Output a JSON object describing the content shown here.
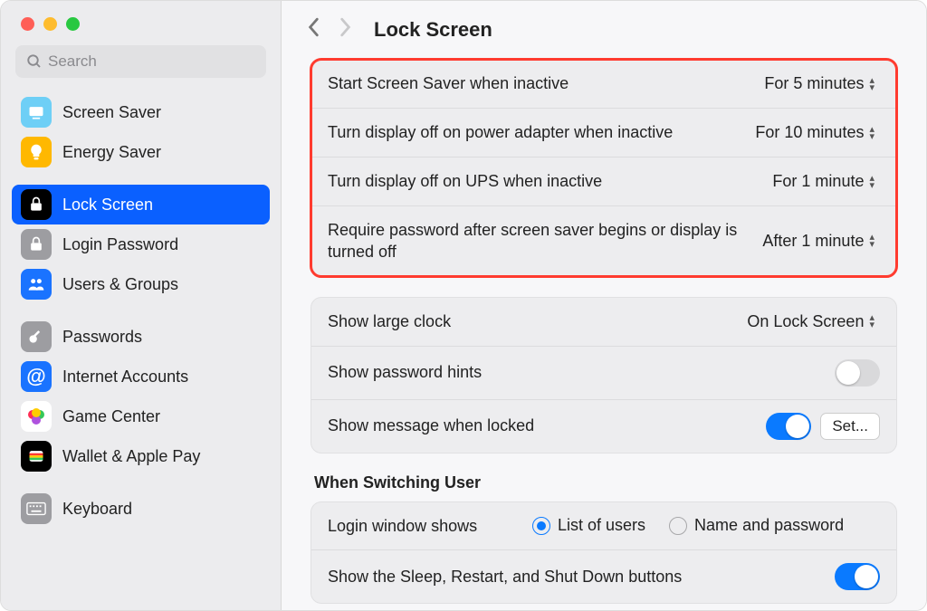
{
  "search": {
    "placeholder": "Search"
  },
  "header": {
    "title": "Lock Screen"
  },
  "sidebar": {
    "groups": [
      [
        {
          "label": "Screen Saver",
          "icon": "screen-saver",
          "bg": "#6ecff6"
        },
        {
          "label": "Energy Saver",
          "icon": "bulb",
          "bg": "#ffb800"
        }
      ],
      [
        {
          "label": "Lock Screen",
          "icon": "lock",
          "bg": "#000000",
          "selected": true
        },
        {
          "label": "Login Password",
          "icon": "lock-solid",
          "bg": "#9d9da1"
        },
        {
          "label": "Users & Groups",
          "icon": "users",
          "bg": "#1a73ff"
        }
      ],
      [
        {
          "label": "Passwords",
          "icon": "key",
          "bg": "#9d9da1"
        },
        {
          "label": "Internet Accounts",
          "icon": "at",
          "bg": "#1a73ff"
        },
        {
          "label": "Game Center",
          "icon": "game-center",
          "bg": "#ffffff"
        },
        {
          "label": "Wallet & Apple Pay",
          "icon": "wallet",
          "bg": "#000000"
        }
      ],
      [
        {
          "label": "Keyboard",
          "icon": "keyboard",
          "bg": "#9d9da1"
        }
      ]
    ]
  },
  "section1": {
    "rows": [
      {
        "label": "Start Screen Saver when inactive",
        "value": "For 5 minutes"
      },
      {
        "label": "Turn display off on power adapter when inactive",
        "value": "For 10 minutes"
      },
      {
        "label": "Turn display off on UPS when inactive",
        "value": "For 1 minute"
      },
      {
        "label": "Require password after screen saver begins or display is turned off",
        "value": "After 1 minute"
      }
    ]
  },
  "section2": {
    "large_clock_label": "Show large clock",
    "large_clock_value": "On Lock Screen",
    "hints_label": "Show password hints",
    "hints_on": false,
    "message_label": "Show message when locked",
    "message_on": true,
    "set_button": "Set..."
  },
  "switching": {
    "heading": "When Switching User",
    "login_window_label": "Login window shows",
    "option_list": "List of users",
    "option_name": "Name and password",
    "selected": "list",
    "sleep_label": "Show the Sleep, Restart, and Shut Down buttons",
    "sleep_on": true
  }
}
